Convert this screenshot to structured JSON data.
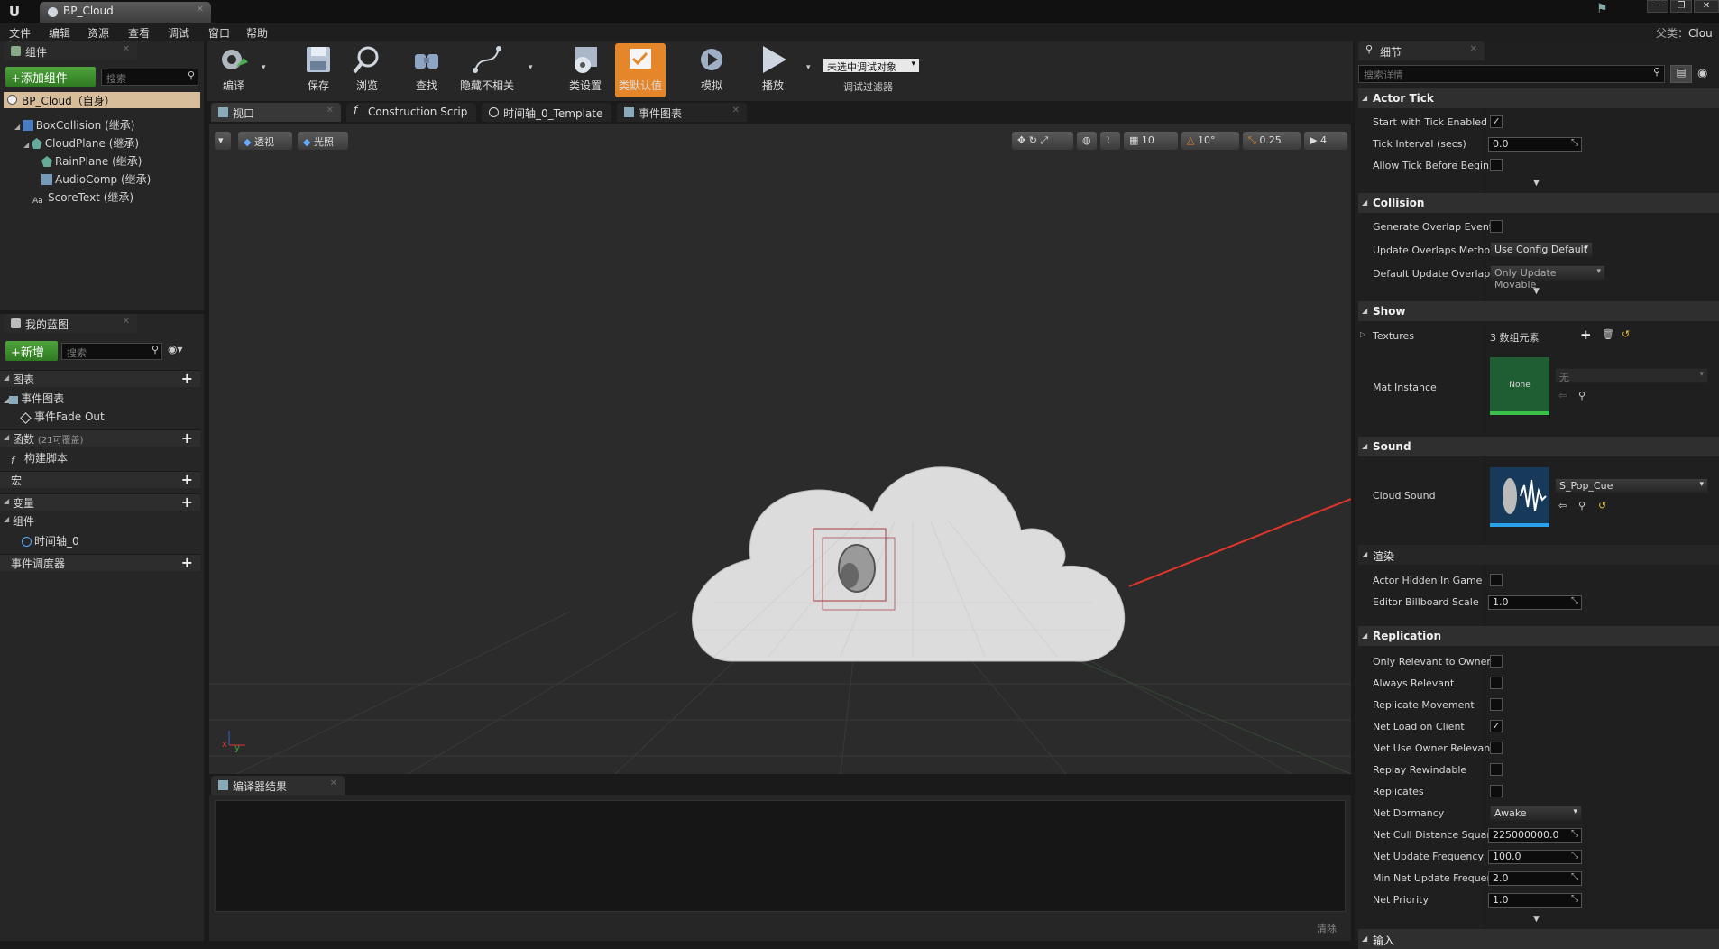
{
  "window": {
    "tab_title": "BP_Cloud",
    "search_parent_label": "父类：",
    "search_parent_value": "Clou"
  },
  "menubar": [
    "文件",
    "编辑",
    "资源",
    "查看",
    "调试",
    "窗口",
    "帮助"
  ],
  "components_panel": {
    "title": "组件",
    "add_button": "+添加组件",
    "search_placeholder": "搜索",
    "root": "BP_Cloud（自身）",
    "items": [
      {
        "label": "BoxCollision (继承)",
        "indent": 1
      },
      {
        "label": "CloudPlane (继承)",
        "indent": 1
      },
      {
        "label": "RainPlane (继承)",
        "indent": 2
      },
      {
        "label": "AudioComp (继承)",
        "indent": 2
      },
      {
        "label": "ScoreText (继承)",
        "indent": 1
      }
    ]
  },
  "my_blueprint": {
    "title": "我的蓝图",
    "new_button": "+新增",
    "search_placeholder": "搜索",
    "categories": {
      "graphs": "图表",
      "event_graph": "事件图表",
      "event_fade_out": "事件Fade Out",
      "functions": "函数",
      "functions_note": "(21可覆盖)",
      "construction": "构建脚本",
      "macros": "宏",
      "variables": "变量",
      "components": "组件",
      "timeline": "时间轴_0",
      "dispatchers": "事件调度器"
    }
  },
  "toolbar": {
    "buttons": [
      "编译",
      "保存",
      "浏览",
      "查找",
      "隐藏不相关",
      "类设置",
      "类默认值",
      "模拟",
      "播放"
    ],
    "debug_combo": "未选中调试对象",
    "debug_filter": "调试过滤器"
  },
  "editor_tabs": [
    "视口",
    "Construction Scrip",
    "时间轴_0_Template",
    "事件图表"
  ],
  "viewport": {
    "btn_perspective": "透视",
    "btn_lit": "光照",
    "grid_snap": "10",
    "rot_snap": "10°",
    "scale_snap": "0.25",
    "cam_speed": "4"
  },
  "compiler": {
    "title": "编译器结果",
    "clear": "清除"
  },
  "details": {
    "title": "细节",
    "search_placeholder": "搜索详情",
    "actor_tick": {
      "title": "Actor Tick",
      "start_with_tick": "Start with Tick Enabled",
      "tick_interval": "Tick Interval (secs)",
      "tick_interval_val": "0.0",
      "allow_tick": "Allow Tick Before Begin"
    },
    "collision": {
      "title": "Collision",
      "gen_overlap": "Generate Overlap Events",
      "update_method": "Update Overlaps Methoc",
      "update_method_val": "Use Config Default",
      "default_update": "Default Update Overlaps",
      "default_update_val": "Only Update Movable"
    },
    "show": {
      "title": "Show",
      "textures": "Textures",
      "textures_val": "3 数组元素",
      "mat_instance": "Mat Instance",
      "mat_thumb": "None",
      "mat_combo": "无"
    },
    "sound": {
      "title": "Sound",
      "cloud_sound": "Cloud Sound",
      "cloud_sound_val": "S_Pop_Cue"
    },
    "rendering": {
      "title": "渲染",
      "hidden": "Actor Hidden In Game",
      "billboard": "Editor Billboard Scale",
      "billboard_val": "1.0"
    },
    "replication": {
      "title": "Replication",
      "rows": [
        {
          "label": "Only Relevant to Owner",
          "type": "chk",
          "checked": false
        },
        {
          "label": "Always Relevant",
          "type": "chk",
          "checked": false
        },
        {
          "label": "Replicate Movement",
          "type": "chk",
          "checked": false
        },
        {
          "label": "Net Load on Client",
          "type": "chk",
          "checked": true
        },
        {
          "label": "Net Use Owner Relevanc",
          "type": "chk",
          "checked": false
        },
        {
          "label": "Replay Rewindable",
          "type": "chk",
          "checked": false
        },
        {
          "label": "Replicates",
          "type": "chk",
          "checked": false
        },
        {
          "label": "Net Dormancy",
          "type": "combo",
          "value": "Awake"
        },
        {
          "label": "Net Cull Distance Square",
          "type": "num",
          "value": "225000000.0"
        },
        {
          "label": "Net Update Frequency",
          "type": "num",
          "value": "100.0"
        },
        {
          "label": "Min Net Update Frequen",
          "type": "num",
          "value": "2.0"
        },
        {
          "label": "Net Priority",
          "type": "num",
          "value": "1.0"
        }
      ]
    },
    "next_cat": "输入"
  }
}
